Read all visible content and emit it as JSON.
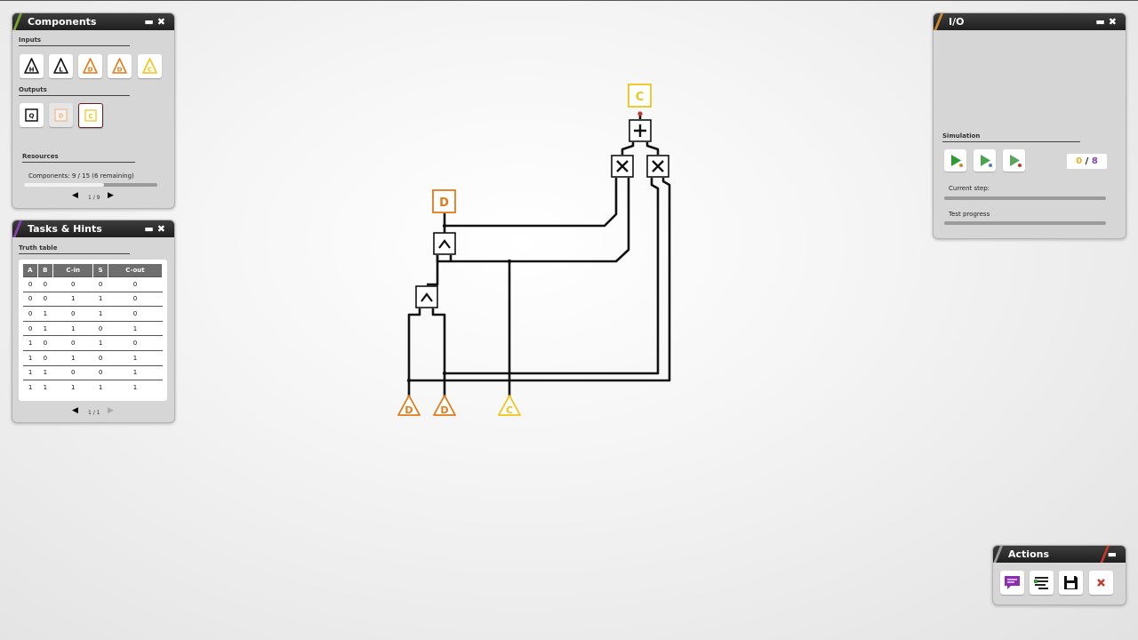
{
  "colors": {
    "d_orange": "#e07b1a",
    "c_yellow": "#f0c419",
    "wire": "#111111",
    "accent_green": "#7aa630",
    "accent_purple": "#8a3fb0",
    "accent_orange": "#d08a2a",
    "accent_red": "#c0392b"
  },
  "components_panel": {
    "title": "Components",
    "inputs_label": "Inputs",
    "inputs": [
      {
        "letter": "H",
        "icon": "input-h-icon"
      },
      {
        "letter": "L",
        "icon": "input-l-icon"
      },
      {
        "letter": "D",
        "icon": "input-d-icon"
      },
      {
        "letter": "D",
        "icon": "input-d-icon"
      },
      {
        "letter": "C",
        "icon": "input-c-icon"
      }
    ],
    "outputs_label": "Outputs",
    "outputs": [
      {
        "letter": "Q",
        "icon": "output-q-icon"
      },
      {
        "letter": "D",
        "icon": "output-d-icon"
      },
      {
        "letter": "C",
        "icon": "output-c-icon"
      }
    ],
    "resources_label": "Resources",
    "components_text": "Components: 9 / 15 (6 remaining)",
    "components_progress": 0.6,
    "pager": "1 / 9"
  },
  "tasks_panel": {
    "title": "Tasks & Hints",
    "truth_table_label": "Truth table",
    "columns": [
      "A",
      "B",
      "C-in",
      "S",
      "C-out"
    ],
    "rows": [
      [
        "0",
        "0",
        "0",
        "0",
        "0"
      ],
      [
        "0",
        "0",
        "1",
        "1",
        "0"
      ],
      [
        "0",
        "1",
        "0",
        "1",
        "0"
      ],
      [
        "0",
        "1",
        "1",
        "0",
        "1"
      ],
      [
        "1",
        "0",
        "0",
        "1",
        "0"
      ],
      [
        "1",
        "0",
        "1",
        "0",
        "1"
      ],
      [
        "1",
        "1",
        "0",
        "0",
        "1"
      ],
      [
        "1",
        "1",
        "1",
        "1",
        "1"
      ]
    ],
    "pager": "1 / 1"
  },
  "io_panel": {
    "title": "I/O",
    "simulation_label": "Simulation",
    "counter_current": "0",
    "counter_sep": "/",
    "counter_total": "8",
    "current_step_label": "Current step:",
    "test_progress_label": "Test progress",
    "current_step_progress": 0,
    "test_progress": 0
  },
  "actions_panel": {
    "title": "Actions",
    "buttons": [
      {
        "name": "hint-button",
        "icon": "speech-bubble-icon"
      },
      {
        "name": "tidy-button",
        "icon": "align-icon"
      },
      {
        "name": "save-button",
        "icon": "floppy-icon"
      },
      {
        "name": "reset-button",
        "icon": "red-x-icon"
      }
    ]
  },
  "circuit": {
    "output_nodes": [
      {
        "letter": "C",
        "color": "c_yellow"
      },
      {
        "letter": "D",
        "color": "d_orange"
      }
    ],
    "input_nodes": [
      {
        "letter": "D",
        "color": "d_orange"
      },
      {
        "letter": "D",
        "color": "d_orange"
      },
      {
        "letter": "C",
        "color": "c_yellow"
      }
    ],
    "gates": [
      {
        "type": "or",
        "symbol": "+"
      },
      {
        "type": "and",
        "symbol": "×"
      },
      {
        "type": "and",
        "symbol": "×"
      },
      {
        "type": "xor",
        "symbol": "^"
      },
      {
        "type": "xor",
        "symbol": "^"
      }
    ]
  }
}
